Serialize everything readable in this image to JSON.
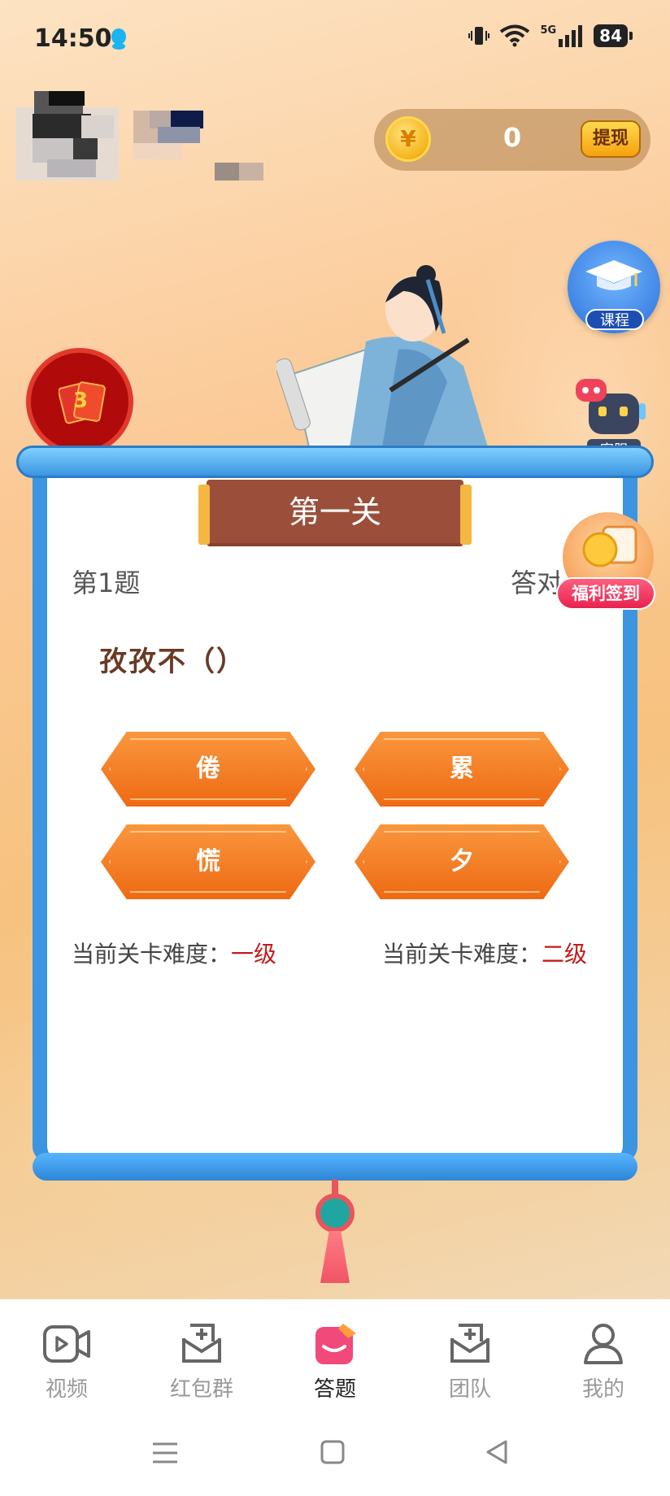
{
  "status_bar": {
    "time": "14:50",
    "network": "5G",
    "battery": "84"
  },
  "header": {
    "coin_symbol": "¥",
    "coin_balance": "0",
    "withdraw_label": "提现"
  },
  "side_buttons": {
    "course_label": "课程",
    "service_label": "客服",
    "checkin_label": "福利签到",
    "redpacket_count": "3"
  },
  "quiz": {
    "level_title": "第一关",
    "question_number": "第1题",
    "correct_label": "答对",
    "question_text": "孜孜不（）",
    "options": [
      "倦",
      "累",
      "慌",
      "夕"
    ],
    "difficulty_label": "当前关卡难度：",
    "difficulty_current": "一级",
    "difficulty_next": "二级"
  },
  "bottom_nav": {
    "items": [
      {
        "label": "视频",
        "icon": "video-icon"
      },
      {
        "label": "红包群",
        "icon": "red-packet-group-icon"
      },
      {
        "label": "答题",
        "icon": "quiz-icon",
        "active": true
      },
      {
        "label": "团队",
        "icon": "team-icon"
      },
      {
        "label": "我的",
        "icon": "profile-icon"
      }
    ]
  },
  "colors": {
    "accent": "#ee6a13",
    "board_blue": "#3b95e0",
    "difficulty_red": "#c21a1a",
    "banner_brown": "#9b4f3a"
  }
}
